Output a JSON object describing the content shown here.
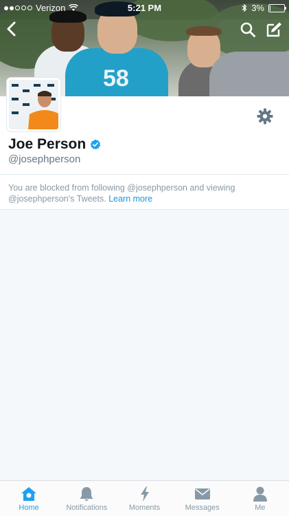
{
  "status_bar": {
    "carrier": "Verizon",
    "time": "5:21 PM",
    "battery": "3%",
    "battery_level": 0.03
  },
  "profile": {
    "name": "Joe Person",
    "handle": "@josephperson",
    "verified": true
  },
  "blocked_notice": {
    "text": "You are blocked from following @josephperson and viewing @josephperson's Tweets.",
    "link": "Learn more"
  },
  "tabs": [
    {
      "label": "Home",
      "icon": "home-icon",
      "active": true
    },
    {
      "label": "Notifications",
      "icon": "bell-icon",
      "active": false
    },
    {
      "label": "Moments",
      "icon": "lightning-icon",
      "active": false
    },
    {
      "label": "Messages",
      "icon": "envelope-icon",
      "active": false
    },
    {
      "label": "Me",
      "icon": "person-icon",
      "active": false
    }
  ],
  "colors": {
    "accent": "#1da1f2",
    "link": "#1b95e0",
    "text_muted": "#8899a6",
    "verified": "#1da1f2"
  }
}
